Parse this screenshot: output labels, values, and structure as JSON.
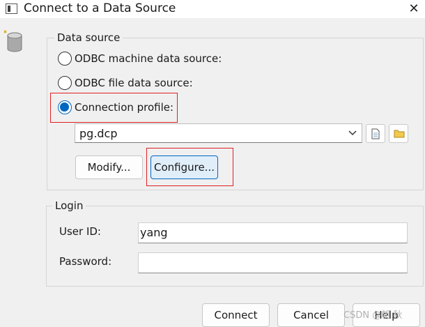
{
  "window": {
    "title": "Connect to a Data Source",
    "close_glyph": "✕"
  },
  "data_source": {
    "legend": "Data source",
    "options": [
      {
        "label": "ODBC machine data source:",
        "checked": false
      },
      {
        "label": "ODBC file data source:",
        "checked": false
      },
      {
        "label": "Connection profile:",
        "checked": true
      }
    ],
    "profile_value": "pg.dcp",
    "modify_label": "Modify...",
    "configure_label": "Configure..."
  },
  "login": {
    "legend": "Login",
    "user_id_label": "User ID:",
    "user_id_value": "yang",
    "password_label": "Password:",
    "password_value": ""
  },
  "footer": {
    "connect_label": "Connect",
    "cancel_label": "Cancel",
    "help_label": "Help",
    "watermark": "CSDN @朝 秋"
  },
  "icons": [
    "window-app-icon",
    "database-icon",
    "chevron-down-icon",
    "new-document-icon",
    "folder-icon",
    "close-icon"
  ],
  "colors": {
    "accent": "#0067c0",
    "highlight": "#e02020"
  }
}
